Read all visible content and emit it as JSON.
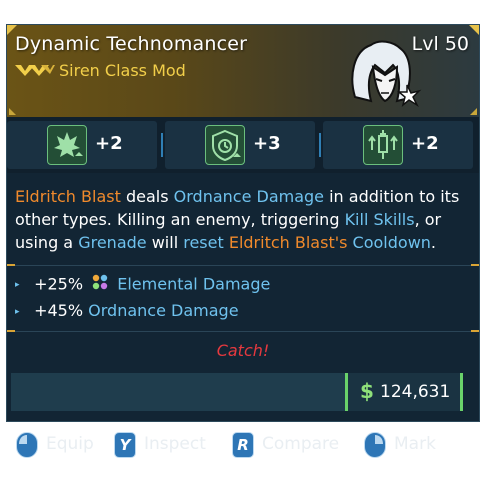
{
  "item": {
    "name": "Dynamic Technomancer",
    "level": "Lvl 50",
    "type": "Siren Class Mod",
    "rarity_color": "#f2cf4a"
  },
  "perks": [
    {
      "icon": "flame-crown-icon",
      "value": "+2"
    },
    {
      "icon": "shield-timer-icon",
      "value": "+3"
    },
    {
      "icon": "syringe-arrows-icon",
      "value": "+2"
    }
  ],
  "description": {
    "parts": [
      {
        "text": "Eldritch Blast",
        "color": "orange"
      },
      {
        "text": " deals ",
        "color": "white"
      },
      {
        "text": "Ordnance Damage",
        "color": "blue"
      },
      {
        "text": " in addition to its other types. Killing an enemy, triggering ",
        "color": "white"
      },
      {
        "text": "Kill Skills",
        "color": "blue"
      },
      {
        "text": ", or using a ",
        "color": "white"
      },
      {
        "text": "Grenade",
        "color": "blue"
      },
      {
        "text": " will ",
        "color": "white"
      },
      {
        "text": "reset",
        "color": "blue"
      },
      {
        "text": " ",
        "color": "white"
      },
      {
        "text": "Eldritch Blast's",
        "color": "orange"
      },
      {
        "text": " ",
        "color": "white"
      },
      {
        "text": "Cooldown",
        "color": "blue"
      },
      {
        "text": ".",
        "color": "white"
      }
    ]
  },
  "bonuses": [
    {
      "amount": "+25%",
      "label": "Elemental Damage",
      "icon": "elemental-icon"
    },
    {
      "amount": "+45%",
      "label": "Ordnance Damage",
      "icon": ""
    }
  ],
  "flavor_text": "Catch!",
  "price": {
    "currency": "$",
    "value": "124,631"
  },
  "actions": [
    {
      "key": "",
      "key_type": "mouse",
      "label": "Equip"
    },
    {
      "key": "Y",
      "key_type": "key",
      "label": "Inspect"
    },
    {
      "key": "R",
      "key_type": "key",
      "label": "Compare"
    },
    {
      "key": "",
      "key_type": "mouse",
      "label": "Mark"
    }
  ],
  "colors": {
    "orange_text": "#f08a2c",
    "blue_text": "#6fc2ee",
    "flavor_red": "#e6393f",
    "money_green": "#8fe17a",
    "header_gold": "#6b5416"
  }
}
